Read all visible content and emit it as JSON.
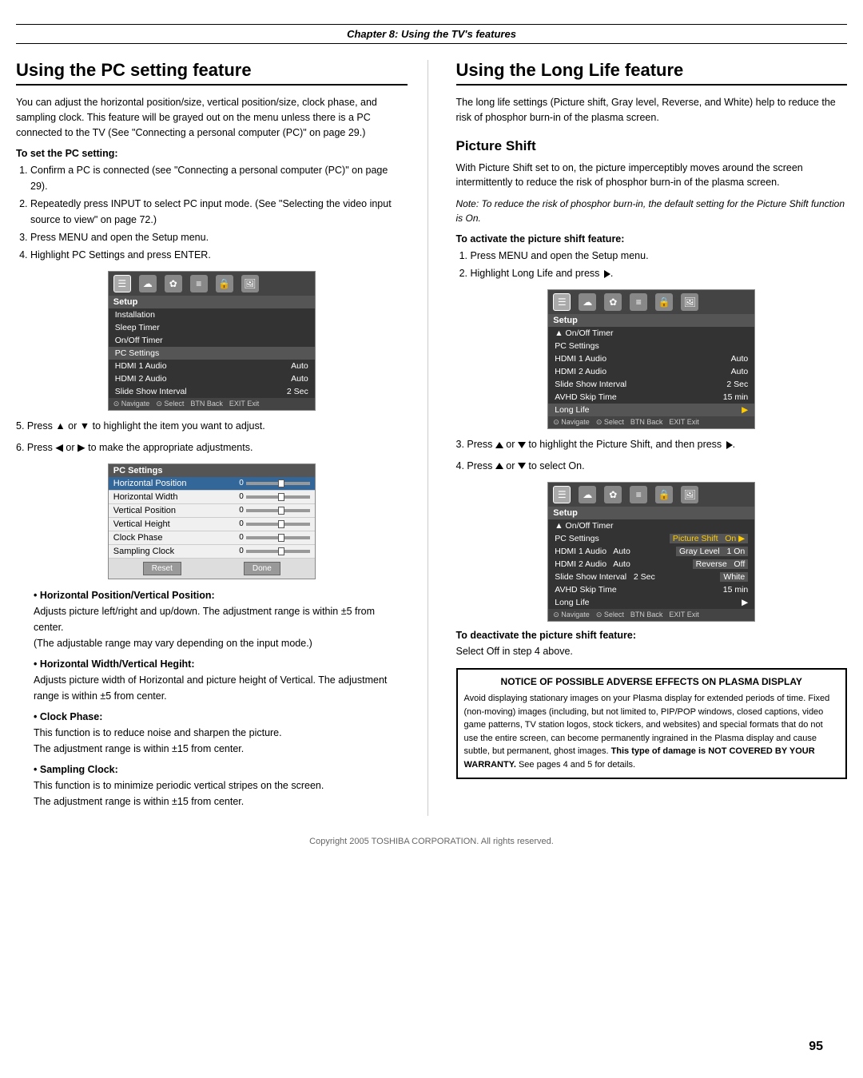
{
  "page": {
    "chapter_header": "Chapter 8: Using the TV's features",
    "footer_text": "Copyright 2005 TOSHIBA CORPORATION. All rights reserved.",
    "page_number": "95"
  },
  "left_section": {
    "title": "Using the PC setting feature",
    "intro": "You can adjust the horizontal position/size, vertical position/size, clock phase, and sampling clock. This feature will be grayed out on the menu unless there is a PC connected to the TV (See \"Connecting a personal computer (PC)\" on page 29.)",
    "subsection_title": "To set the PC setting:",
    "steps": [
      "Confirm a PC is connected (see \"Connecting a personal computer (PC)\" on page 29).",
      "Repeatedly press INPUT to select PC input mode. (See \"Selecting the video input source to view\" on page 72.)",
      "Press MENU and open the Setup menu.",
      "Highlight PC Settings and press ENTER."
    ],
    "step5": "Press ▲ or ▼ to highlight the item you want to adjust.",
    "step6": "Press ◀ or ▶ to make the appropriate adjustments.",
    "menu1": {
      "icons": [
        "☰",
        "☁",
        "✿",
        "≡",
        "🔒",
        "📷"
      ],
      "title": "Setup",
      "items": [
        {
          "label": "Installation",
          "value": ""
        },
        {
          "label": "Sleep Timer",
          "value": ""
        },
        {
          "label": "On/Off Timer",
          "value": ""
        },
        {
          "label": "PC Settings",
          "value": "",
          "highlighted": true
        },
        {
          "label": "HDMI 1 Audio",
          "value": "Auto"
        },
        {
          "label": "HDMI 2 Audio",
          "value": "Auto"
        },
        {
          "label": "Slide Show Interval",
          "value": "2 Sec"
        }
      ],
      "nav": "Navigate  Select  Back  Exit"
    },
    "menu2": {
      "title": "PC Settings",
      "rows": [
        {
          "label": "Horizontal Position",
          "value": "0",
          "highlighted": true
        },
        {
          "label": "Horizontal Width",
          "value": "0"
        },
        {
          "label": "Vertical Position",
          "value": "0"
        },
        {
          "label": "Vertical Height",
          "value": "0"
        },
        {
          "label": "Clock Phase",
          "value": "0"
        },
        {
          "label": "Sampling Clock",
          "value": "0"
        }
      ],
      "buttons": [
        "Reset",
        "Done"
      ]
    },
    "bullets": [
      {
        "header": "Horizontal Position/Vertical Position:",
        "text": "Adjusts picture left/right and up/down. The adjustment range is within ±5 from center.",
        "note": "(The adjustable range may vary depending on the input mode.)"
      },
      {
        "header": "Horizontal Width/Vertical Hegiht:",
        "text": "Adjusts picture width of Horizontal and picture height of Vertical. The adjustment range is within ±5 from center."
      },
      {
        "header": "Clock Phase:",
        "text": "This function is to reduce noise and sharpen the picture.",
        "note2": "The adjustment range is within ±15 from center."
      },
      {
        "header": "Sampling Clock:",
        "text": "This function is to minimize periodic vertical stripes on the screen.",
        "note2": "The adjustment range is within ±15 from center."
      }
    ]
  },
  "right_section": {
    "title": "Using the Long Life feature",
    "intro": "The long life settings (Picture shift, Gray level, Reverse, and White) help to reduce the risk of phosphor burn-in of the plasma screen.",
    "sub_title": "Picture Shift",
    "picture_shift_intro": "With Picture Shift set to on, the picture imperceptibly moves around the screen intermittently to reduce the risk of phosphor burn-in of the plasma screen.",
    "note_italic": "Note: To reduce the risk of phosphor burn-in, the default setting for the Picture Shift function is On.",
    "activate_title": "To activate the picture shift feature:",
    "activate_steps": [
      "Press MENU and open the Setup menu.",
      "Highlight Long Life and press ▶."
    ],
    "menu3": {
      "items": [
        {
          "label": "On/Off Timer",
          "value": ""
        },
        {
          "label": "PC Settings",
          "value": ""
        },
        {
          "label": "HDMI 1 Audio",
          "value": "Auto"
        },
        {
          "label": "HDMI 2 Audio",
          "value": "Auto"
        },
        {
          "label": "Slide Show Interval",
          "value": "2 Sec"
        },
        {
          "label": "AVHD Skip Time",
          "value": "15 min"
        },
        {
          "label": "Long Life",
          "value": "▶",
          "highlighted": true
        }
      ]
    },
    "step3": "Press ▲ or ▼ to highlight the Picture Shift, and then press ▶.",
    "step4": "Press ▲ or ▼ to select On.",
    "menu4": {
      "items": [
        {
          "label": "On/Off Timer",
          "value": ""
        },
        {
          "label": "PC Settings",
          "value": ""
        },
        {
          "label": "HDMI 1 Audio",
          "value": "Auto",
          "sub": "Picture Shift",
          "subval": "On ▶"
        },
        {
          "label": "HDMI 2 Audio",
          "value": "Auto",
          "sub": "Gray Level",
          "subval": "1 On"
        },
        {
          "label": "Slide Show Interval",
          "value": "2 Sec",
          "sub": "Reverse",
          "subval": "Off"
        },
        {
          "label": "AVHD Skip Time",
          "value": "15 min",
          "sub": "White",
          "subval": ""
        },
        {
          "label": "Long Life",
          "value": "▶"
        }
      ]
    },
    "deactivate_title": "To deactivate the picture shift feature:",
    "deactivate_text": "Select Off in step 4 above.",
    "notice": {
      "title": "NOTICE OF POSSIBLE ADVERSE EFFECTS ON PLASMA DISPLAY",
      "text": "Avoid displaying stationary images on your Plasma display for extended periods of time. Fixed (non-moving) images (including, but not limited to, PIP/POP windows, closed captions, video game patterns, TV station logos, stock tickers, and websites) and special formats that do not use the entire screen, can become permanently ingrained in the Plasma display and cause subtle, but permanent, ghost images. ",
      "bold_text": "This type of damage is NOT COVERED BY YOUR WARRANTY.",
      "end_text": "  See pages 4 and 5 for details."
    }
  }
}
